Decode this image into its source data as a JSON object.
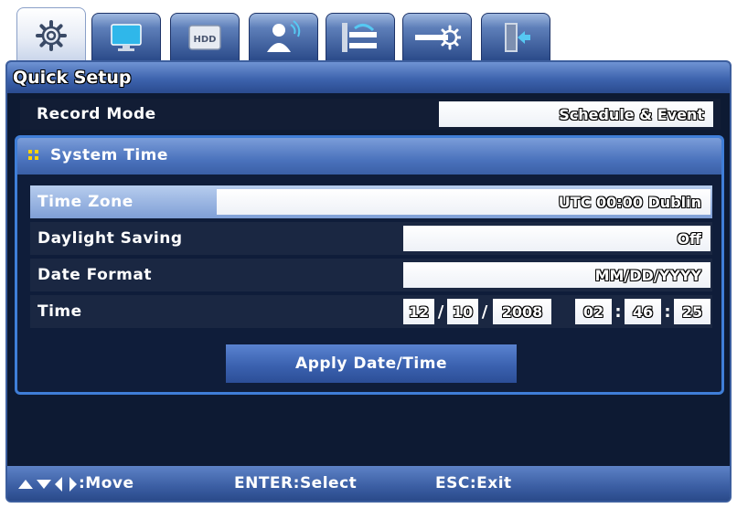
{
  "tabs": [
    {
      "icon": "gear-icon",
      "active": true
    },
    {
      "icon": "monitor-icon",
      "active": false
    },
    {
      "icon": "hdd-icon",
      "label": "HDD",
      "active": false
    },
    {
      "icon": "user-network-icon",
      "active": false
    },
    {
      "icon": "network-icon",
      "active": false
    },
    {
      "icon": "device-settings-icon",
      "active": false
    },
    {
      "icon": "exit-icon",
      "active": false
    }
  ],
  "panel": {
    "title": "Quick Setup"
  },
  "record_mode": {
    "label": "Record Mode",
    "value": "Schedule & Event"
  },
  "system_time": {
    "title": "System Time",
    "time_zone": {
      "label": "Time Zone",
      "value": "UTC 00:00 Dublin"
    },
    "daylight_saving": {
      "label": "Daylight Saving",
      "value": "Off"
    },
    "date_format": {
      "label": "Date Format",
      "value": "MM/DD/YYYY"
    },
    "time": {
      "label": "Time",
      "month": "12",
      "day": "10",
      "year": "2008",
      "hour": "02",
      "minute": "46",
      "second": "25",
      "date_sep": "/",
      "time_sep": ":"
    },
    "apply_label": "Apply Date/Time"
  },
  "footer": {
    "move": ":Move",
    "select": "ENTER:Select",
    "exit": "ESC:Exit"
  },
  "colors": {
    "panel_bg": "#0d1a33",
    "accent_blue": "#3f7ed8",
    "dots": "#ffd200"
  }
}
